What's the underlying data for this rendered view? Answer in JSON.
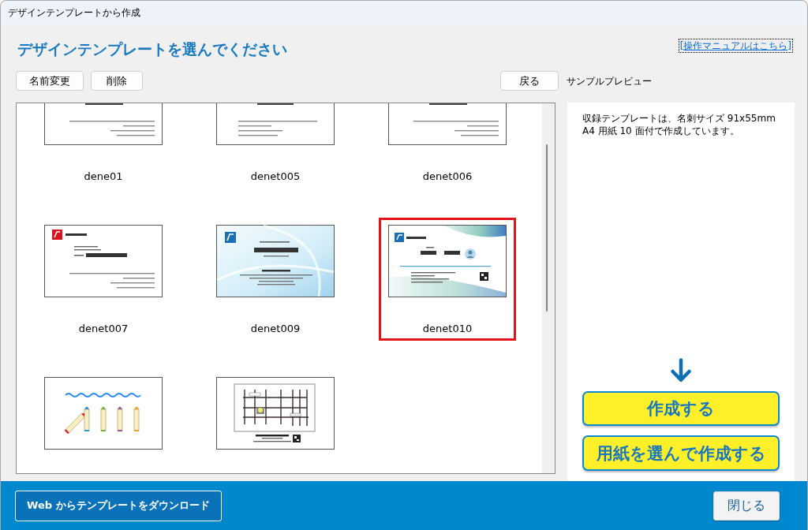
{
  "window": {
    "title": "デザインテンプレートから作成"
  },
  "header": {
    "heading": "デザインテンプレートを選んでください",
    "manual_link": {
      "text": "[操作マニュアルはこちら]",
      "focused": true
    }
  },
  "toolbar": {
    "buttons": [
      "名前変更",
      "削除"
    ],
    "back_button": "戻る",
    "preview_label": "サンプルプレビュー"
  },
  "templates": [
    {
      "label": "dene01",
      "kind": "plain",
      "selected": false
    },
    {
      "label": "denet005",
      "kind": "plain-left",
      "selected": false
    },
    {
      "label": "denet006",
      "kind": "plain",
      "selected": false
    },
    {
      "label": "denet007",
      "kind": "logo-red",
      "selected": false
    },
    {
      "label": "denet009",
      "kind": "wave-blue",
      "selected": false
    },
    {
      "label": "denet010",
      "kind": "wave-teal",
      "selected": true
    },
    {
      "kind": "crayons",
      "selected": false
    },
    {
      "kind": "map",
      "selected": false
    }
  ],
  "preview": {
    "description": "収録テンプレートは、名刺サイズ 91x55mm\nA4 用紙 10 面付で作成しています。",
    "buttons": [
      "作成する",
      "用紙を選んで作成する"
    ]
  },
  "footer": {
    "download_button": "Web からテンプレートをダウンロード",
    "close_button": "閉じる"
  }
}
